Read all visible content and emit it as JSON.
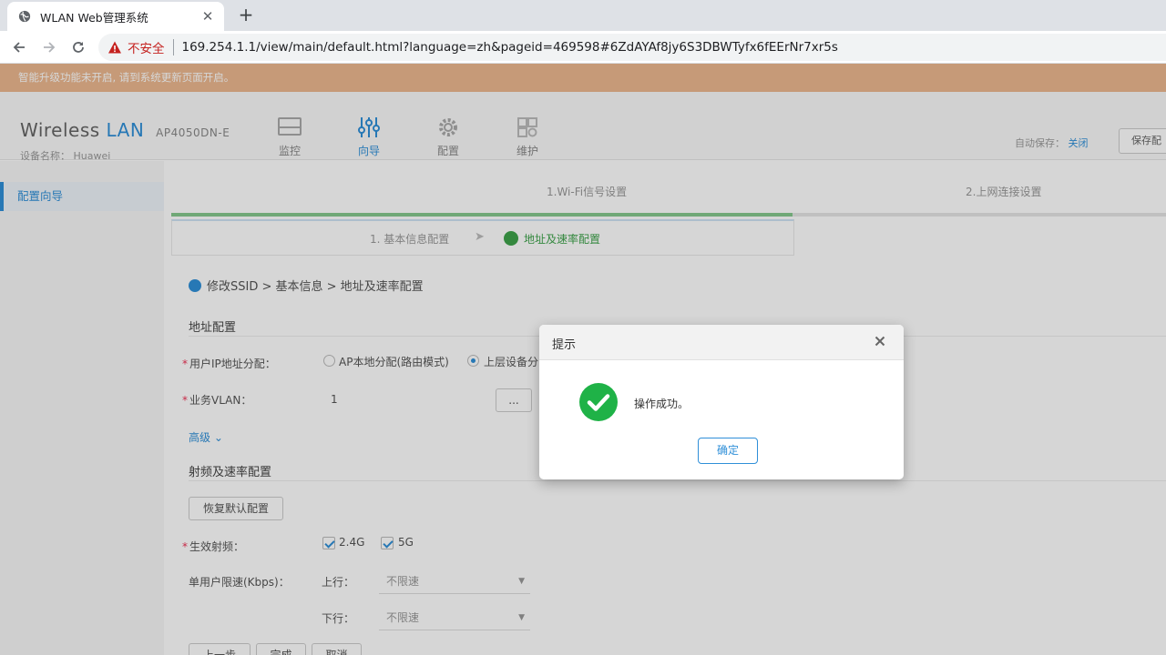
{
  "browser": {
    "tab_title": "WLAN Web管理系统",
    "insecure_label": "不安全",
    "url": "169.254.1.1/view/main/default.html?language=zh&pageid=469598#6ZdAYAf8jy6S3DBWTyfx6fEErNr7xr5s"
  },
  "notice": "智能升级功能未开启, 请到系统更新页面开启。",
  "header": {
    "brand_a": "Wireless",
    "brand_b": "LAN",
    "model": "AP4050DN-E",
    "device_name": "设备名称： Huawei",
    "nav": [
      "监控",
      "向导",
      "配置",
      "维护"
    ],
    "autosave_label": "自动保存：",
    "autosave_value": "关闭",
    "save_label": "保存配"
  },
  "sidebar": {
    "item": "配置向导"
  },
  "steps": {
    "step1": "1.Wi-Fi信号设置",
    "step2": "2.上网连接设置"
  },
  "substeps": {
    "a": "1. 基本信息配置",
    "b": "地址及速率配置"
  },
  "breadcrumb": "修改SSID > 基本信息 > 地址及速率配置",
  "form": {
    "addr_section": "地址配置",
    "ip_label": "用户IP地址分配：",
    "ip_opt1": "AP本地分配(路由模式)",
    "ip_opt2": "上层设备分",
    "vlan_label": "业务VLAN：",
    "vlan_value": "1",
    "vlan_btn": "...",
    "advanced": "高级",
    "rf_section": "射频及速率配置",
    "restore_btn": "恢复默认配置",
    "band_label": "生效射频：",
    "band_24": "2.4G",
    "band_5": "5G",
    "rate_label": "单用户限速(Kbps)：",
    "up_label": "上行：",
    "up_value": "不限速",
    "down_label": "下行：",
    "down_value": "不限速",
    "btn_prev": "上一步",
    "btn_finish": "完成",
    "btn_cancel": "取消"
  },
  "dialog": {
    "title": "提示",
    "message": "操作成功。",
    "ok": "确定"
  },
  "colors": {
    "accent": "#2f8fd8",
    "success": "#1fb247",
    "notice": "#ecb88f",
    "insecure": "#c5221f"
  }
}
